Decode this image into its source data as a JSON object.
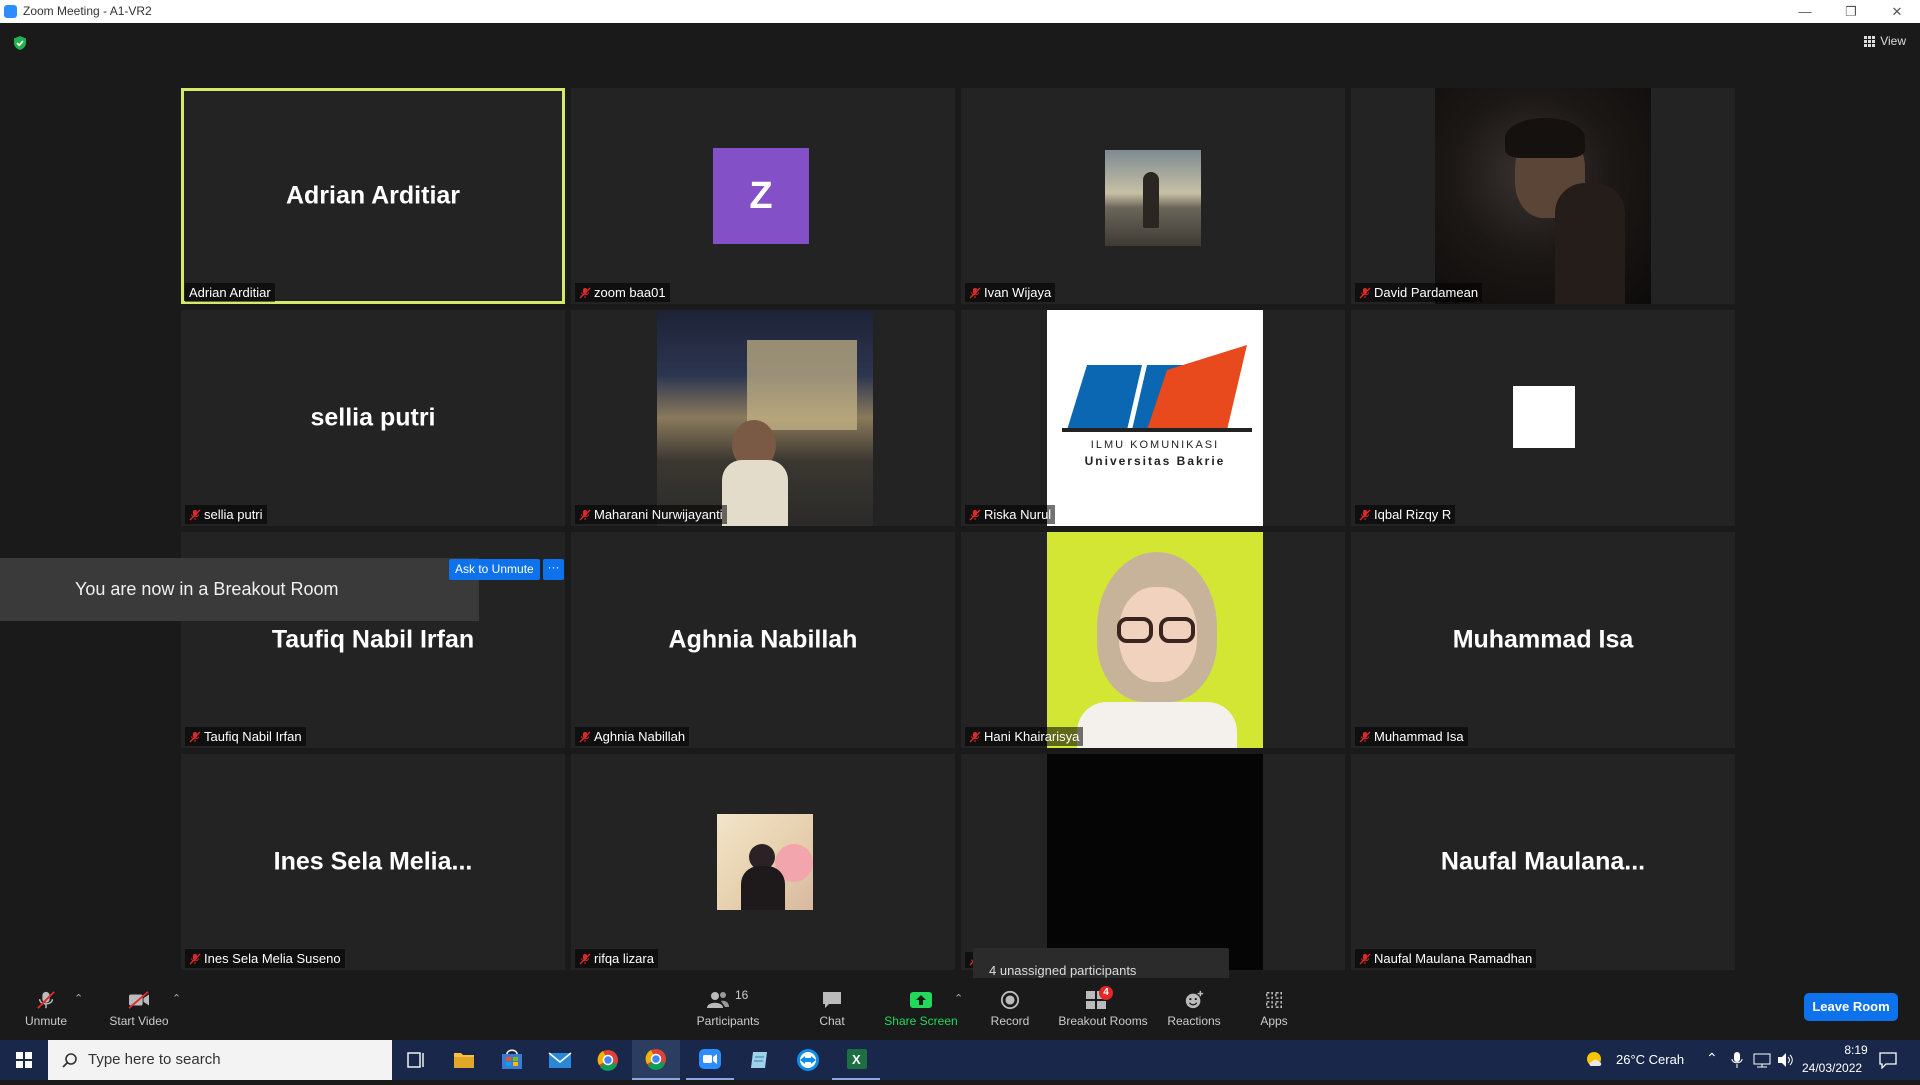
{
  "window": {
    "title": "Zoom Meeting - A1-VR2"
  },
  "top": {
    "view_label": "View"
  },
  "tiles": [
    {
      "big_name": "Adrian Arditiar",
      "label": "Adrian Arditiar"
    },
    {
      "avatar_letter": "Z",
      "label": "zoom baa01"
    },
    {
      "label": "Ivan Wijaya"
    },
    {
      "label": "David Pardamean"
    },
    {
      "big_name": "sellia putri",
      "label": "sellia putri"
    },
    {
      "label": "Maharani Nurwijayanti"
    },
    {
      "label": "Riska Nurul",
      "logo_text_1": "ILMU KOMUNIKASI",
      "logo_text_2": "Universitas Bakrie"
    },
    {
      "label": "Iqbal Rizqy R"
    },
    {
      "big_name": "Taufiq Nabil Irfan",
      "label": "Taufiq Nabil Irfan"
    },
    {
      "big_name": "Aghnia Nabillah",
      "label": "Aghnia Nabillah"
    },
    {
      "label": "Hani Khairarisya"
    },
    {
      "big_name": "Muhammad Isa",
      "label": "Muhammad Isa"
    },
    {
      "big_name": "Ines Sela Melia...",
      "label": "Ines Sela Melia Suseno"
    },
    {
      "label": "rifqa lizara"
    },
    {
      "label": ""
    },
    {
      "big_name": "Naufal  Maulana...",
      "label": "Naufal Maulana Ramadhan"
    }
  ],
  "overlays": {
    "toast": "You are now in a Breakout Room",
    "ask_unmute": "Ask to Unmute",
    "more": "···",
    "unassigned": "4 unassigned participants"
  },
  "toolbar": {
    "unmute": "Unmute",
    "start_video": "Start Video",
    "participants": "Participants",
    "participants_count": "16",
    "chat": "Chat",
    "share_screen": "Share Screen",
    "record": "Record",
    "breakout_rooms": "Breakout Rooms",
    "breakout_badge": "4",
    "reactions": "Reactions",
    "apps": "Apps",
    "leave_room": "Leave Room"
  },
  "taskbar": {
    "search_placeholder": "Type here to search",
    "weather": "26°C  Cerah",
    "time": "8:19",
    "date": "24/03/2022"
  },
  "colors": {
    "active_speaker": "#d4ea6b",
    "accent_blue": "#0e72ed",
    "share_green": "#23d959",
    "avatar_purple": "#8350c8",
    "badge_red": "#e02828"
  }
}
